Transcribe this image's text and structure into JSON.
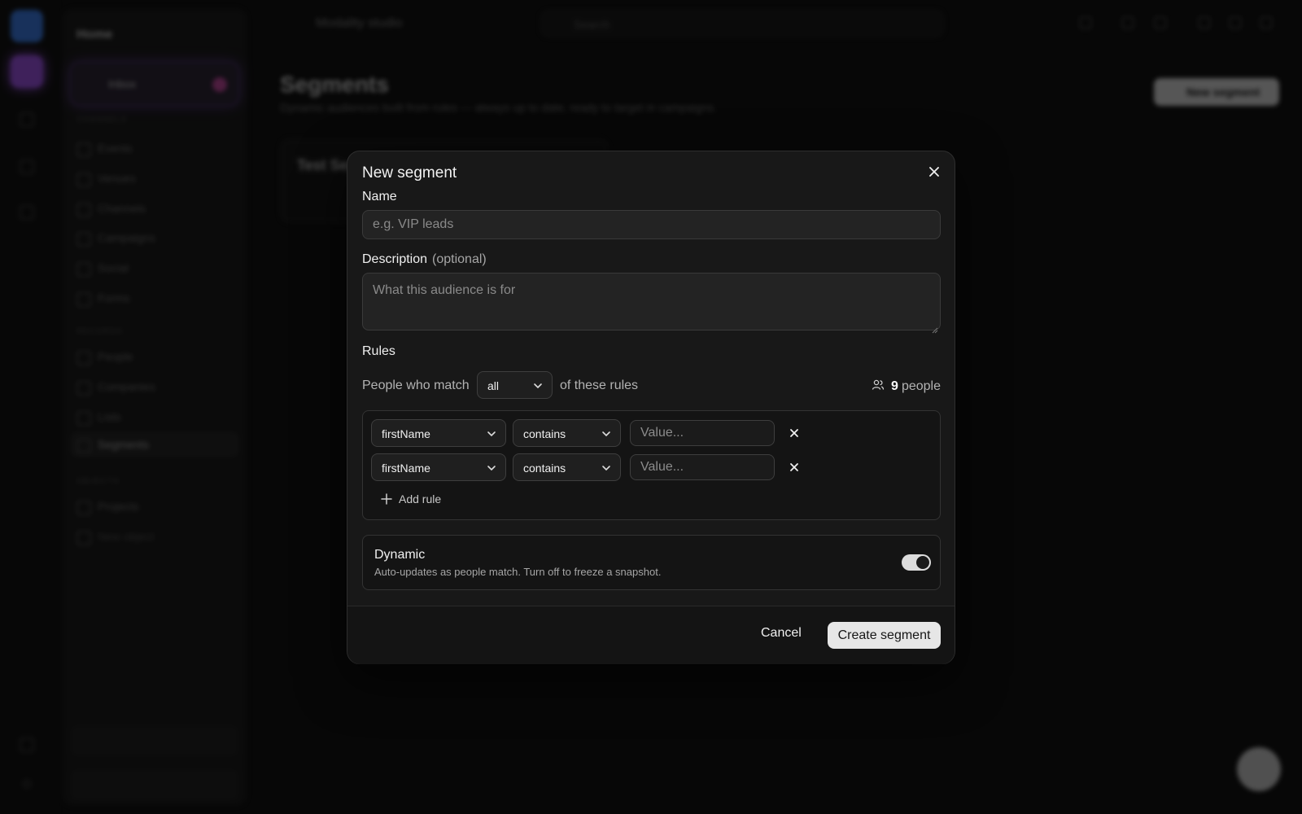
{
  "background": {
    "app_title": "Modality studio",
    "search_placeholder": "Search",
    "page_title": "Segments",
    "page_subtitle": "Dynamic audiences built from rules — always up to date, ready to target in campaigns.",
    "new_segment_label": "New segment",
    "card_title": "Test Seg",
    "sidebar": {
      "title": "Home",
      "inbox_label": "Inbox",
      "sections": [
        "CHANNELS",
        "RECORDS",
        "OBJECTS"
      ],
      "items": [
        "Events",
        "Venues",
        "Channels",
        "Campaigns",
        "Social",
        "Forms",
        "People",
        "Companies",
        "Lists",
        "Segments",
        "Projects",
        "New object"
      ]
    },
    "accent_color": "#3b82f6"
  },
  "modal": {
    "title": "New segment",
    "name_label": "Name",
    "name_placeholder": "e.g. VIP leads",
    "name_value": "",
    "description_label": "Description",
    "description_optional": "(optional)",
    "description_placeholder": "What this audience is for",
    "rules_label": "Rules",
    "match_prefix": "People who match",
    "match_mode": "all",
    "match_suffix": "of these rules",
    "people_count": "9",
    "people_label": "people",
    "rules": [
      {
        "field": "firstName",
        "operator": "contains",
        "value_placeholder": "Value..."
      },
      {
        "field": "firstName",
        "operator": "contains",
        "value_placeholder": "Value..."
      }
    ],
    "add_rule_label": "Add rule",
    "dynamic_title": "Dynamic",
    "dynamic_description": "Auto-updates as people match. Turn off to freeze a snapshot.",
    "dynamic_enabled": true,
    "cancel_label": "Cancel",
    "create_label": "Create segment"
  }
}
